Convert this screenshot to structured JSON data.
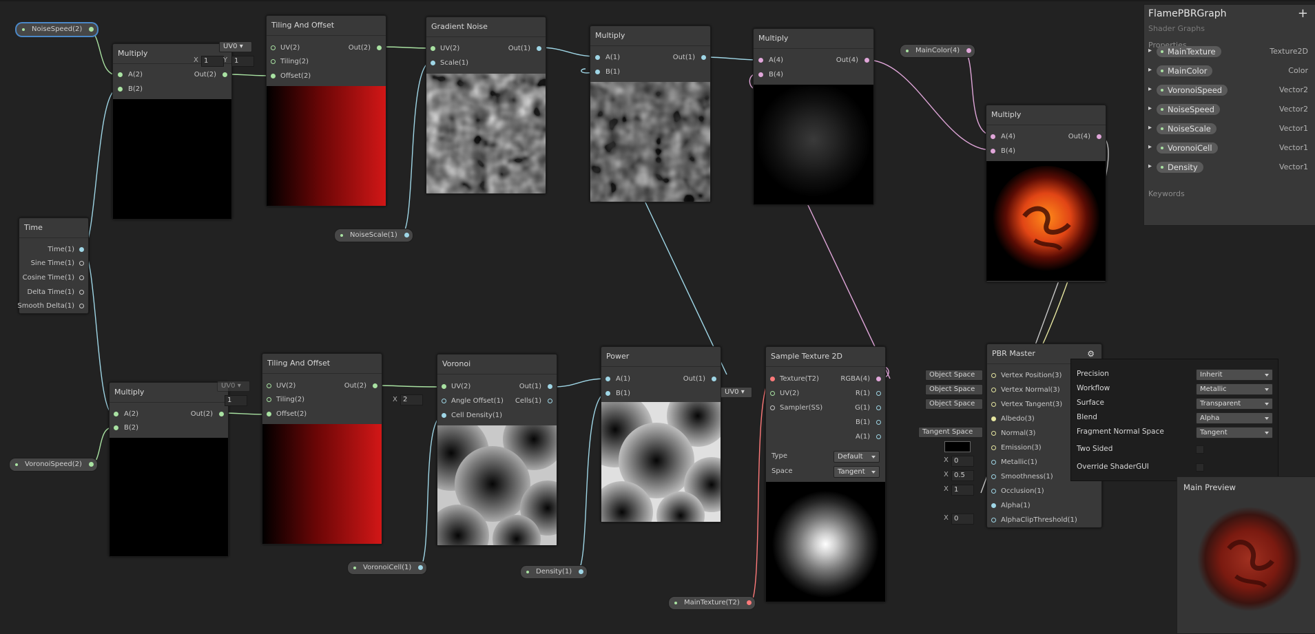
{
  "graph": {
    "time": {
      "title": "Time",
      "ports": [
        "Time(1)",
        "Sine Time(1)",
        "Cosine Time(1)",
        "Delta Time(1)",
        "Smooth Delta(1)"
      ]
    },
    "multiply_top": {
      "title": "Multiply",
      "in_a": "A(2)",
      "in_b": "B(2)",
      "out": "Out(2)"
    },
    "tiling_top": {
      "title": "Tiling And Offset",
      "in_uv": "UV(2)",
      "in_tiling": "Tiling(2)",
      "in_offset": "Offset(2)",
      "out": "Out(2)",
      "uv_chip": "UV0",
      "x_label": "X",
      "x_val": "1",
      "y_label": "Y",
      "y_val": "1"
    },
    "gradient_noise": {
      "title": "Gradient Noise",
      "in_uv": "UV(2)",
      "in_scale": "Scale(1)",
      "out": "Out(1)"
    },
    "multiply_mid": {
      "title": "Multiply",
      "in_a": "A(1)",
      "in_b": "B(1)",
      "out": "Out(1)"
    },
    "multiply_right": {
      "title": "Multiply",
      "in_a": "A(4)",
      "in_b": "B(4)",
      "out": "Out(4)"
    },
    "multiply_color": {
      "title": "Multiply",
      "in_a": "A(4)",
      "in_b": "B(4)",
      "out": "Out(4)"
    },
    "multiply_bottom": {
      "title": "Multiply",
      "in_a": "A(2)",
      "in_b": "B(2)",
      "out": "Out(2)"
    },
    "tiling_bottom": {
      "title": "Tiling And Offset",
      "in_uv": "UV(2)",
      "in_tiling": "Tiling(2)",
      "in_offset": "Offset(2)",
      "out": "Out(2)",
      "uv_chip": "UV0",
      "x_val": "1"
    },
    "voronoi": {
      "title": "Voronoi",
      "in_uv": "UV(2)",
      "in_angle": "Angle Offset(1)",
      "in_density": "Cell Density(1)",
      "out": "Out(1)",
      "out_cells": "Cells(1)",
      "x_label": "X",
      "x_val": "2"
    },
    "power": {
      "title": "Power",
      "in_a": "A(1)",
      "in_b": "B(1)",
      "out": "Out(1)"
    },
    "sample_texture": {
      "title": "Sample Texture 2D",
      "in_tex": "Texture(T2)",
      "in_uv": "UV(2)",
      "in_sampler": "Sampler(SS)",
      "out_rgba": "RGBA(4)",
      "out_r": "R(1)",
      "out_g": "G(1)",
      "out_b": "B(1)",
      "out_a": "A(1)",
      "uv_chip": "UV0",
      "type_label": "Type",
      "type_val": "Default",
      "space_label": "Space",
      "space_val": "Tangent"
    },
    "pbr_master": {
      "title": "PBR Master",
      "ports": [
        "Vertex Position(3)",
        "Vertex Normal(3)",
        "Vertex Tangent(3)",
        "Albedo(3)",
        "Normal(3)",
        "Emission(3)",
        "Metallic(1)",
        "Smoothness(1)",
        "Occlusion(1)",
        "Alpha(1)",
        "AlphaClipThreshold(1)"
      ],
      "space_chips": [
        "Object Space",
        "Object Space",
        "Object Space"
      ],
      "normal_chip": "Tangent Space",
      "metallic": "0",
      "smoothness": "0.5",
      "occlusion": "1",
      "alpha_clip": "0",
      "x_label": "X"
    },
    "pills": {
      "noise_speed": "NoiseSpeed(2)",
      "noise_scale": "NoiseScale(1)",
      "main_color": "MainColor(4)",
      "voronoi_speed": "VoronoiSpeed(2)",
      "voronoi_cell": "VoronoiCell(1)",
      "density": "Density(1)",
      "main_texture": "MainTexture(T2)"
    }
  },
  "blackboard": {
    "title": "FlamePBRGraph",
    "subtitle": "Shader Graphs",
    "add_label": "+",
    "properties_label": "Properties",
    "keywords_label": "Keywords",
    "properties": [
      {
        "name": "MainTexture",
        "type": "Texture2D"
      },
      {
        "name": "MainColor",
        "type": "Color"
      },
      {
        "name": "VoronoiSpeed",
        "type": "Vector2"
      },
      {
        "name": "NoiseSpeed",
        "type": "Vector2"
      },
      {
        "name": "NoiseScale",
        "type": "Vector1"
      },
      {
        "name": "VoronoiCell",
        "type": "Vector1"
      },
      {
        "name": "Density",
        "type": "Vector1"
      }
    ]
  },
  "master_settings": {
    "rows": [
      {
        "label": "Precision",
        "value": "Inherit"
      },
      {
        "label": "Workflow",
        "value": "Metallic"
      },
      {
        "label": "Surface",
        "value": "Transparent"
      },
      {
        "label": "Blend",
        "value": "Alpha"
      },
      {
        "label": "Fragment Normal Space",
        "value": "Tangent"
      }
    ],
    "two_sided": "Two Sided",
    "override_gui": "Override ShaderGUI"
  },
  "main_preview": {
    "title": "Main Preview"
  },
  "colors": {
    "vector1": "#9fd6e6",
    "vector2": "#a9e2a2",
    "vector4": "#e0a6d9",
    "texture": "#ff7a7a",
    "vector3": "#e6e6a0",
    "background": "#222222",
    "node": "#393939"
  }
}
